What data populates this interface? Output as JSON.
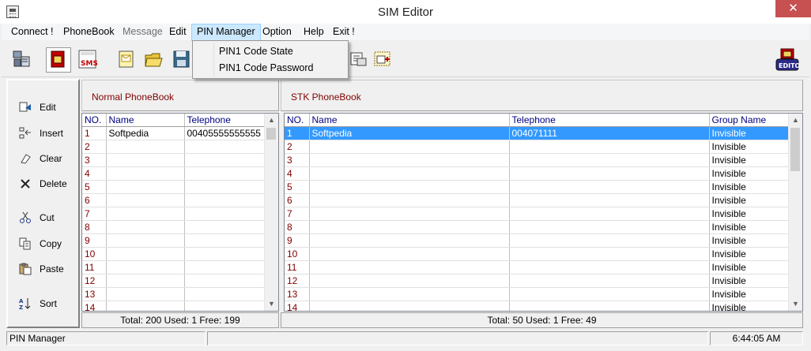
{
  "window": {
    "title": "SIM Editor",
    "close_glyph": "✕"
  },
  "menu": {
    "items": [
      {
        "label": "Connect !",
        "state": "normal"
      },
      {
        "label": "PhoneBook",
        "state": "normal"
      },
      {
        "label": "Message",
        "state": "disabled"
      },
      {
        "label": "Edit",
        "state": "normal"
      },
      {
        "label": "PIN Manager",
        "state": "active"
      },
      {
        "label": "Option",
        "state": "normal"
      },
      {
        "label": "Help",
        "state": "normal"
      },
      {
        "label": "Exit !",
        "state": "normal"
      }
    ]
  },
  "dropdown": {
    "items": [
      "PIN1 Code State",
      "PIN1 Code Password"
    ]
  },
  "toolbar": {
    "icons": [
      "connect-icon",
      "sim-card-icon",
      "sms-icon",
      "message-icon",
      "open-folder-icon",
      "save-icon",
      "phonebook-export-icon",
      "phonebook-import-icon",
      "editor-logo-icon"
    ]
  },
  "sidebar": {
    "items": [
      {
        "label": "Edit",
        "icon": "edit-icon"
      },
      {
        "label": "Insert",
        "icon": "insert-icon"
      },
      {
        "label": "Clear",
        "icon": "clear-icon"
      },
      {
        "label": "Delete",
        "icon": "delete-icon"
      },
      {
        "label": "Cut",
        "icon": "cut-icon"
      },
      {
        "label": "Copy",
        "icon": "copy-icon"
      },
      {
        "label": "Paste",
        "icon": "paste-icon"
      },
      {
        "label": "Sort",
        "icon": "sort-icon"
      }
    ]
  },
  "normal_phonebook": {
    "title": "Normal  PhoneBook",
    "columns": [
      "NO.",
      "Name",
      "Telephone"
    ],
    "rows": [
      [
        "1",
        "Softpedia",
        "00405555555555"
      ],
      [
        "2",
        "",
        ""
      ],
      [
        "3",
        "",
        ""
      ],
      [
        "4",
        "",
        ""
      ],
      [
        "5",
        "",
        ""
      ],
      [
        "6",
        "",
        ""
      ],
      [
        "7",
        "",
        ""
      ],
      [
        "8",
        "",
        ""
      ],
      [
        "9",
        "",
        ""
      ],
      [
        "10",
        "",
        ""
      ],
      [
        "11",
        "",
        ""
      ],
      [
        "12",
        "",
        ""
      ],
      [
        "13",
        "",
        ""
      ],
      [
        "14",
        "",
        ""
      ]
    ],
    "footer": "Total: 200  Used: 1   Free: 199"
  },
  "stk_phonebook": {
    "title": "STK  PhoneBook",
    "columns": [
      "NO.",
      "Name",
      "Telephone",
      "Group Name"
    ],
    "rows": [
      [
        "1",
        "Softpedia",
        "004071111",
        "Invisible"
      ],
      [
        "2",
        "",
        "",
        "Invisible"
      ],
      [
        "3",
        "",
        "",
        "Invisible"
      ],
      [
        "4",
        "",
        "",
        "Invisible"
      ],
      [
        "5",
        "",
        "",
        "Invisible"
      ],
      [
        "6",
        "",
        "",
        "Invisible"
      ],
      [
        "7",
        "",
        "",
        "Invisible"
      ],
      [
        "8",
        "",
        "",
        "Invisible"
      ],
      [
        "9",
        "",
        "",
        "Invisible"
      ],
      [
        "10",
        "",
        "",
        "Invisible"
      ],
      [
        "11",
        "",
        "",
        "Invisible"
      ],
      [
        "12",
        "",
        "",
        "Invisible"
      ],
      [
        "13",
        "",
        "",
        "Invisible"
      ],
      [
        "14",
        "",
        "",
        "Invisible"
      ]
    ],
    "selected_row": 0,
    "footer": "Total: 50  Used: 1  Free: 49"
  },
  "statusbar": {
    "text": "PIN Manager",
    "time": "6:44:05 AM"
  },
  "colors": {
    "selection": "#3399ff",
    "number_text": "#800000",
    "header_text": "#000080",
    "menu_active": "#cce8ff"
  }
}
